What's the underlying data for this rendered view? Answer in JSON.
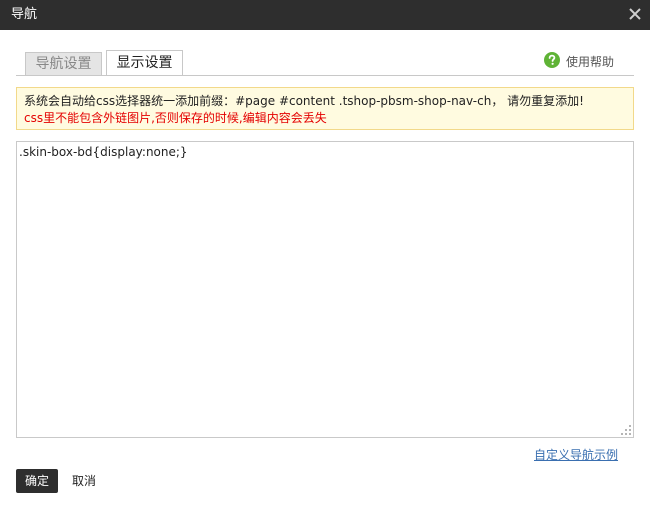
{
  "dialog": {
    "title": "导航",
    "close_icon": "close-icon"
  },
  "tabs": [
    {
      "label": "导航设置",
      "active": false
    },
    {
      "label": "显示设置",
      "active": true
    }
  ],
  "help": {
    "icon": "question-circle-icon",
    "label": "使用帮助",
    "color": "#5fb336"
  },
  "notice": {
    "line1": "系统会自动给css选择器统一添加前缀：#page #content .tshop-pbsm-shop-nav-ch， 请勿重复添加!",
    "line2": "css里不能包含外链图片,否则保存的时候,编辑内容会丢失"
  },
  "editor": {
    "value": ".skin-box-bd{display:none;}"
  },
  "example_link": "自定义导航示例",
  "buttons": {
    "ok": "确定",
    "cancel": "取消"
  }
}
